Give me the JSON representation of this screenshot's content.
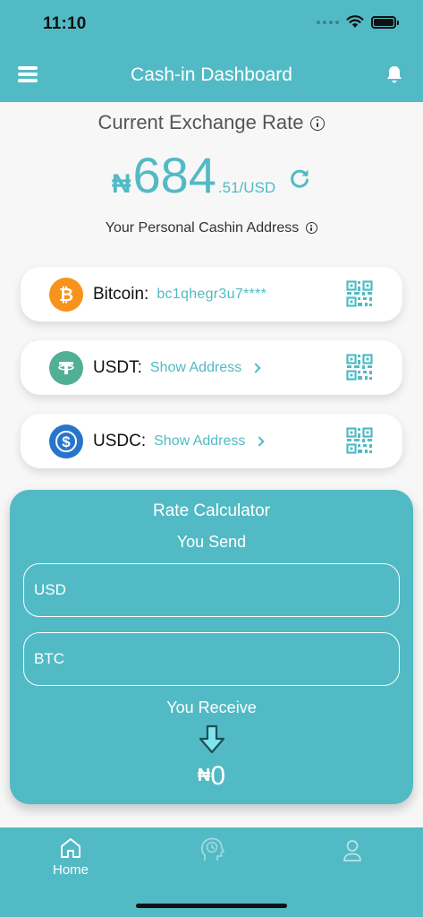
{
  "status_bar": {
    "time": "11:10"
  },
  "header": {
    "title": "Cash-in Dashboard"
  },
  "exchange": {
    "title": "Current Exchange Rate",
    "currency_symbol": "₦",
    "rate_whole": "684",
    "rate_fraction": ".51/USD"
  },
  "address_section": {
    "title": "Your Personal Cashin Address"
  },
  "wallets": [
    {
      "name": "Bitcoin:",
      "address": "bc1qhegr3u7****",
      "color": "#f7931a"
    },
    {
      "name": "USDT:",
      "action": "Show Address",
      "color": "#50af95"
    },
    {
      "name": "USDC:",
      "action": "Show Address",
      "color": "#2775ca"
    }
  ],
  "calculator": {
    "title": "Rate Calculator",
    "send_label": "You Send",
    "currency_from": "USD",
    "currency_to": "BTC",
    "receive_label": "You Receive",
    "result_symbol": "₦",
    "result_value": "0"
  },
  "nav": {
    "home_label": "Home"
  },
  "colors": {
    "accent": "#52bac4"
  }
}
